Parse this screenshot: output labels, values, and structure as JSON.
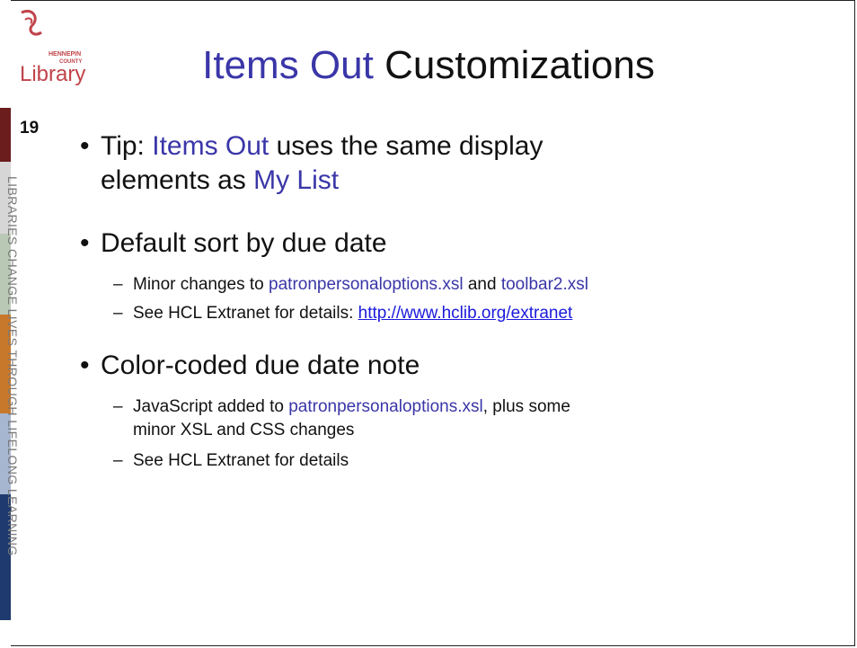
{
  "logo": {
    "line1": "HENNEPIN",
    "line2": "COUNTY",
    "word": "Library"
  },
  "slide_number": "19",
  "tagline": "LIBRARIES CHANGE LIVES THROUGH LIFELONG LEARNING",
  "title": {
    "blue": "Items Out",
    "rest": " Customizations"
  },
  "bullets": [
    {
      "pre": "Tip: ",
      "blue1": "Items Out",
      "mid": " uses the same display",
      "line2pre": "elements as ",
      "blue2": "My List"
    },
    {
      "text": "Default sort by due date"
    },
    {
      "text": "Color-coded due date note"
    }
  ],
  "subs": [
    {
      "pre": "Minor changes to ",
      "blue1": "patronpersonaloptions.xsl",
      "mid": " and ",
      "blue2": "toolbar2.xsl"
    },
    {
      "pre": "See HCL Extranet for details: ",
      "link": "http://www.hclib.org/extranet"
    },
    {
      "blue1": "JavaScript added to ",
      "blue": "patronpersonaloptions.xsl",
      "rest": ", plus some",
      "line2": "minor XSL and CSS changes"
    },
    {
      "text": "See HCL Extranet for details"
    }
  ],
  "colors": {
    "accent": "#3a36a8",
    "link": "#1a1adc",
    "band_red": "#7a1f1f",
    "band_orange": "#c8782a",
    "band_blue": "#1f3f7a"
  }
}
